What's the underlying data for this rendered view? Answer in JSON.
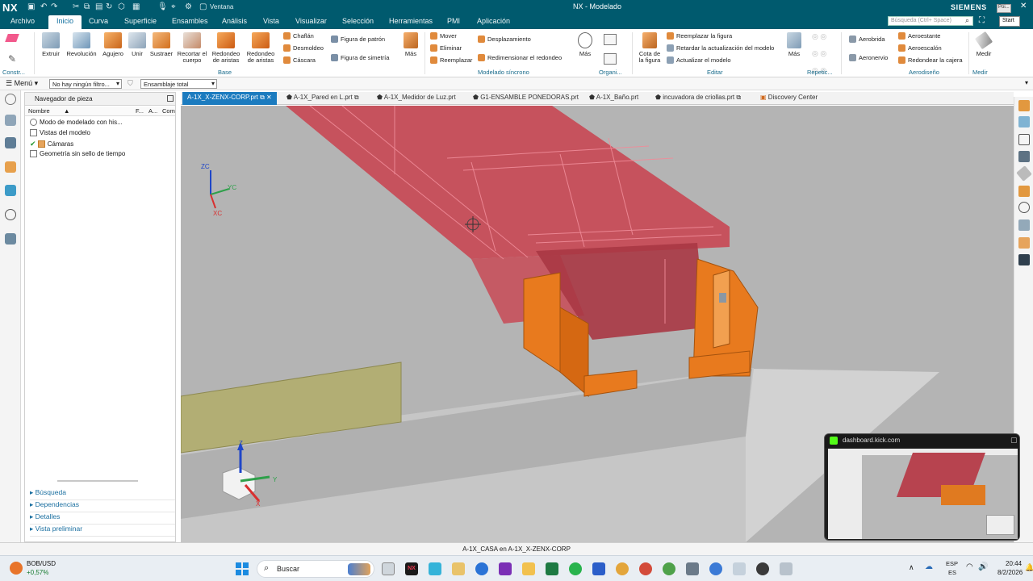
{
  "app": {
    "logo": "NX",
    "title": "NX - Modelado",
    "brand": "SIEMENS",
    "window_menu": "Ventana",
    "search_placeholder": "Búsqueda (Ctrl+ Space)",
    "popup_start": "Start",
    "popup_small": "Poi..."
  },
  "menubar": [
    "Archivo",
    "Inicio",
    "Curva",
    "Superficie",
    "Ensambles",
    "Análisis",
    "Vista",
    "Visualizar",
    "Selección",
    "Herramientas",
    "PMI",
    "Aplicación"
  ],
  "ribbon": {
    "large": [
      {
        "label": "Extruir",
        "icon": "extrude-icon"
      },
      {
        "label": "Revolución",
        "icon": "revolve-icon"
      },
      {
        "label": "Agujero",
        "icon": "hole-icon"
      },
      {
        "label": "Unir",
        "icon": "unite-icon"
      },
      {
        "label": "Sustraer",
        "icon": "subtract-icon"
      },
      {
        "label": "Recortar el cuerpo",
        "icon": "trim-body-icon"
      },
      {
        "label": "Redondeo de aristas",
        "icon": "edge-blend-icon"
      },
      {
        "label": "Redondeo de aristas",
        "icon": "edge-blend-more-icon"
      }
    ],
    "small1": [
      "Chaflán",
      "Desmoldeo",
      "Cáscara"
    ],
    "small2": [
      "Figura de patrón",
      "Figura de simetría"
    ],
    "mas": "Más",
    "small3": [
      "Mover",
      "Eliminar",
      "Reemplazar"
    ],
    "small4": [
      "Desplazamiento",
      "Redimensionar el redondeo"
    ],
    "small5": [
      "Reemplazar la figura",
      "Retardar la actualización del modelo",
      "Actualizar el modelo"
    ],
    "cota": "Cota de la figura",
    "small6": [
      "Aerobrida",
      "Aeronervio"
    ],
    "small7": [
      "Aeroestante",
      "Aeroescalón",
      "Redondear la cajera"
    ],
    "medir": "Medir",
    "groups": [
      "Constr...",
      "Base",
      "Modelado síncrono",
      "Organi...",
      "Editar",
      "Repetic...",
      "Aerodiseño",
      "Medir"
    ]
  },
  "toolbar2": {
    "menu": "Menú",
    "filter": "No hay ningún filtro...",
    "assembly": "Ensamblaje total"
  },
  "tabs": [
    "A-1X_X-ZENX-CORP.prt",
    "A-1X_Pared en L.prt",
    "A-1X_Medidor de Luz.prt",
    "G1-ENSAMBLE PONEDORAS.prt",
    "A-1X_Baño.prt",
    "incuvadora de criollas.prt",
    "Discovery Center"
  ],
  "navigator": {
    "title": "Navegador de pieza",
    "cols": [
      "Nombre",
      "F...",
      "A...",
      "Com"
    ],
    "items": [
      "Modo de modelado con his...",
      "Vistas del modelo",
      "Cámaras",
      "Geometría sin sello de tiempo"
    ],
    "bottom": [
      "Búsqueda",
      "Dependencias",
      "Detalles",
      "Vista preliminar"
    ]
  },
  "viewport": {
    "triad_small": {
      "z": "ZC",
      "y": "YC",
      "x": "XC"
    },
    "triad_main": {
      "z": "Z",
      "y": "Y",
      "x": "X"
    }
  },
  "status": "A-1X_CASA en A-1X_X-ZENX-CORP",
  "pip": {
    "url": "dashboard.kick.com"
  },
  "taskbar": {
    "ticker": "BOB/USD",
    "change": "+0,57%",
    "search": "Buscar",
    "lang1": "ESP",
    "lang2": "ES",
    "time": "20:44",
    "date": "8/2/2026"
  },
  "colors": {
    "title": "#005a6e",
    "tab_active": "#1b7bbf",
    "red_body": "#e0475a",
    "orange_body": "#e87a1e",
    "olive": "#b5b07a",
    "viewport_bg": "#b4b4b4"
  }
}
